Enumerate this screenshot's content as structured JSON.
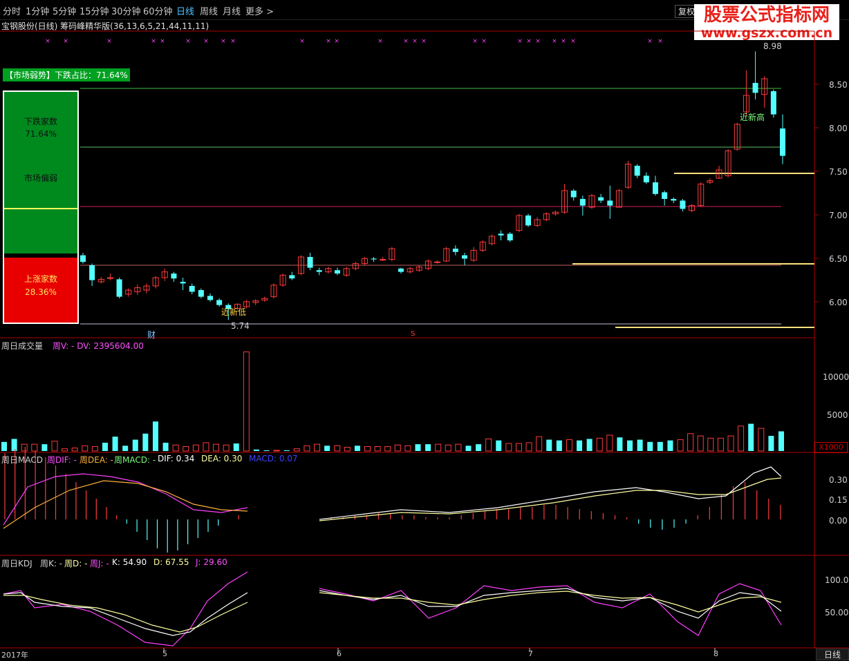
{
  "topbar": {
    "tabs": [
      {
        "label": "分时",
        "active": false
      },
      {
        "label": "1分钟",
        "active": false
      },
      {
        "label": "5分钟",
        "active": false
      },
      {
        "label": "15分钟",
        "active": false
      },
      {
        "label": "30分钟",
        "active": false
      },
      {
        "label": "60分钟",
        "active": false
      },
      {
        "label": "日线",
        "active": true
      },
      {
        "label": "周线",
        "active": false
      },
      {
        "label": "月线",
        "active": false
      },
      {
        "label": "更多 >",
        "active": false
      }
    ],
    "restore_label": "复权",
    "watermark_main": "股票公式指标网",
    "watermark_sub": "www.gszx.com.cn"
  },
  "title_line": "宝钢股份(日线) 筹码峰精华版(36,13,6,5,21,44,11,11)",
  "market_panel": {
    "header": "【市场弱势】下跌占比：71.64%",
    "fall_label": "下跌家数",
    "fall_pct": "71.64%",
    "status": "市场偏弱",
    "rise_label": "上涨家数",
    "rise_pct": "28.36%",
    "fall_fraction": 0.7164,
    "rise_fraction": 0.2836
  },
  "annotations": {
    "new_low": "近新低",
    "new_high": "近新高",
    "low_price": "5.74",
    "high_price": "8.98",
    "cai_marker": "财",
    "s_marker": "S"
  },
  "price_axis": [
    "8.50",
    "8.00",
    "7.50",
    "7.00",
    "6.50",
    "6.00"
  ],
  "volume_panel": {
    "title": "周日成交量",
    "line": "周V: -  DV: 2395604.00",
    "axis": [
      "10000",
      "5000"
    ],
    "unit": "X1000"
  },
  "macd_panel": {
    "title": "周日MACD",
    "dif_label": "周DIF: -",
    "dea_label": "周DEA: -",
    "macd_label": "周MACD: -",
    "dif_value": "DIF: 0.34",
    "dea_value": "DEA: 0.30",
    "macd_value": "MACD: 0.07",
    "axis": [
      "0.30",
      "0.15",
      "0.00"
    ]
  },
  "kdj_panel": {
    "title": "周日KDJ",
    "k_label": "周K: -",
    "d_label": "周D: -",
    "j_label": "周J: -",
    "k_value": "K: 54.90",
    "d_value": "D: 67.55",
    "j_value": "J: 29.60",
    "axis": [
      "100.0",
      "50.00"
    ]
  },
  "time_axis": [
    "2017年",
    "5",
    "6",
    "7",
    "8"
  ],
  "period_button": "日线",
  "colors": {
    "up": "#ff3c3c",
    "down": "#54ffff",
    "panel_border": "#b00000"
  },
  "chart_data": {
    "type": "candlestick",
    "price_range": [
      5.6,
      9.1
    ],
    "candles": [
      [
        6.52,
        6.44,
        6.55,
        6.42
      ],
      [
        6.4,
        6.22,
        6.42,
        6.15
      ],
      [
        6.2,
        6.23,
        6.26,
        6.18
      ],
      [
        6.24,
        6.25,
        6.3,
        6.22
      ],
      [
        6.23,
        6.02,
        6.25,
        6.0
      ],
      [
        6.05,
        6.1,
        6.12,
        6.02
      ],
      [
        6.08,
        6.13,
        6.17,
        6.04
      ],
      [
        6.1,
        6.15,
        6.18,
        6.06
      ],
      [
        6.15,
        6.25,
        6.27,
        6.12
      ],
      [
        6.25,
        6.32,
        6.36,
        6.21
      ],
      [
        6.3,
        6.24,
        6.32,
        6.2
      ],
      [
        6.2,
        6.18,
        6.25,
        6.1
      ],
      [
        6.15,
        6.08,
        6.18,
        6.05
      ],
      [
        6.1,
        6.02,
        6.12,
        6.0
      ],
      [
        6.03,
        5.98,
        6.06,
        5.96
      ],
      [
        5.98,
        5.92,
        6.0,
        5.9
      ],
      [
        5.92,
        5.87,
        5.94,
        5.74
      ],
      [
        5.88,
        5.93,
        5.94,
        5.86
      ],
      [
        5.9,
        5.96,
        5.98,
        5.88
      ],
      [
        5.95,
        5.97,
        5.99,
        5.92
      ],
      [
        5.98,
        6.0,
        6.02,
        5.96
      ],
      [
        6.02,
        6.16,
        6.18,
        6.0
      ],
      [
        6.16,
        6.28,
        6.3,
        6.14
      ],
      [
        6.28,
        6.24,
        6.32,
        6.22
      ],
      [
        6.3,
        6.5,
        6.52,
        6.28
      ],
      [
        6.5,
        6.37,
        6.55,
        6.34
      ],
      [
        6.34,
        6.32,
        6.37,
        6.28
      ],
      [
        6.32,
        6.36,
        6.38,
        6.3
      ],
      [
        6.34,
        6.3,
        6.37,
        6.28
      ],
      [
        6.28,
        6.36,
        6.38,
        6.26
      ],
      [
        6.36,
        6.42,
        6.44,
        6.34
      ],
      [
        6.42,
        6.48,
        6.5,
        6.4
      ],
      [
        6.48,
        6.47,
        6.5,
        6.44
      ],
      [
        6.47,
        6.47,
        6.5,
        6.45
      ],
      [
        6.47,
        6.6,
        6.62,
        6.45
      ],
      [
        6.36,
        6.32,
        6.37,
        6.3
      ],
      [
        6.32,
        6.36,
        6.38,
        6.3
      ],
      [
        6.34,
        6.38,
        6.4,
        6.32
      ],
      [
        6.36,
        6.45,
        6.47,
        6.34
      ],
      [
        6.44,
        6.44,
        6.46,
        6.42
      ],
      [
        6.45,
        6.6,
        6.62,
        6.44
      ],
      [
        6.6,
        6.56,
        6.64,
        6.52
      ],
      [
        6.52,
        6.48,
        6.55,
        6.4
      ],
      [
        6.46,
        6.58,
        6.62,
        6.44
      ],
      [
        6.58,
        6.68,
        6.7,
        6.56
      ],
      [
        6.66,
        6.75,
        6.77,
        6.64
      ],
      [
        6.78,
        6.76,
        6.82,
        6.7
      ],
      [
        6.78,
        6.7,
        6.8,
        6.68
      ],
      [
        6.82,
        7.0,
        7.02,
        6.8
      ],
      [
        7.0,
        6.88,
        7.02,
        6.86
      ],
      [
        6.88,
        6.95,
        6.98,
        6.86
      ],
      [
        6.95,
        7.02,
        7.04,
        6.93
      ],
      [
        7.02,
        7.04,
        7.06,
        7.0
      ],
      [
        7.04,
        7.3,
        7.38,
        7.02
      ],
      [
        7.3,
        7.22,
        7.32,
        7.18
      ],
      [
        7.2,
        7.12,
        7.24,
        7.0
      ],
      [
        7.1,
        7.24,
        7.26,
        7.08
      ],
      [
        7.22,
        7.18,
        7.26,
        7.15
      ],
      [
        7.18,
        7.12,
        7.36,
        6.96
      ],
      [
        7.1,
        7.3,
        7.32,
        7.1
      ],
      [
        7.34,
        7.62,
        7.66,
        7.32
      ],
      [
        7.6,
        7.48,
        7.62,
        7.45
      ],
      [
        7.48,
        7.4,
        7.52,
        7.38
      ],
      [
        7.4,
        7.26,
        7.48,
        7.24
      ],
      [
        7.28,
        7.2,
        7.3,
        7.12
      ],
      [
        7.2,
        7.18,
        7.22,
        7.15
      ],
      [
        7.18,
        7.08,
        7.2,
        7.05
      ],
      [
        7.06,
        7.12,
        7.14,
        7.04
      ],
      [
        7.12,
        7.38,
        7.4,
        7.1
      ],
      [
        7.4,
        7.42,
        7.45,
        7.38
      ],
      [
        7.45,
        7.55,
        7.6,
        7.44
      ],
      [
        7.48,
        7.78,
        7.8,
        7.46
      ],
      [
        7.8,
        8.1,
        8.12,
        7.78
      ],
      [
        8.25,
        8.45,
        8.75,
        8.2
      ],
      [
        8.6,
        8.48,
        8.98,
        8.4
      ],
      [
        8.46,
        8.65,
        8.68,
        8.3
      ],
      [
        8.5,
        8.22,
        8.52,
        8.18
      ],
      [
        8.05,
        7.72,
        8.22,
        7.62
      ]
    ],
    "volume_thousand": [
      1200,
      1600,
      900,
      900,
      900,
      1300,
      300,
      400,
      700,
      600,
      1100,
      1900,
      700,
      1500,
      2300,
      3900,
      1100,
      800,
      600,
      800,
      1100,
      900,
      800,
      1000,
      13100,
      200,
      100,
      100,
      100,
      300,
      700,
      900,
      700,
      700,
      500,
      700,
      600,
      600,
      600,
      800,
      700,
      900,
      900,
      900,
      800,
      900,
      700,
      900,
      1600,
      1400,
      1000,
      1000,
      1100,
      1900,
      1500,
      1400,
      1500,
      1400,
      1600,
      1700,
      2100,
      1800,
      1400,
      1500,
      1200,
      1200,
      1400,
      1500,
      2300,
      2000,
      1700,
      1700,
      2000,
      3300,
      3600,
      3000,
      2000,
      2600
    ],
    "kdj_k": [
      82,
      75,
      66,
      60,
      58,
      56,
      54,
      50,
      45,
      40,
      36,
      32,
      30,
      28,
      30,
      60,
      75,
      80,
      85,
      90,
      95,
      98,
      100,
      95,
      90,
      80,
      72,
      70,
      68,
      70,
      72,
      75,
      80,
      85,
      88,
      90,
      92,
      95,
      98,
      100,
      95,
      85,
      80,
      78,
      85,
      90,
      95,
      92,
      85,
      78,
      70,
      60,
      55,
      58,
      60,
      65,
      72,
      80,
      85,
      90,
      88,
      82,
      76,
      70,
      66,
      60,
      55,
      58,
      62,
      68,
      72,
      78,
      82,
      86,
      88,
      84,
      78,
      60
    ],
    "ylim_kdj": [
      0,
      120
    ]
  }
}
